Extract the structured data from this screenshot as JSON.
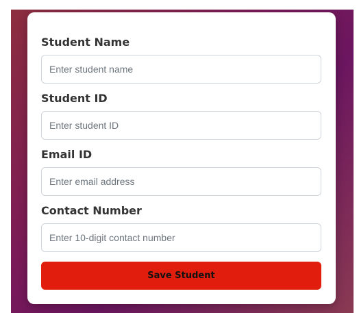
{
  "form": {
    "fields": [
      {
        "label": "Student Name",
        "placeholder": "Enter student name",
        "value": ""
      },
      {
        "label": "Student ID",
        "placeholder": "Enter student ID",
        "value": ""
      },
      {
        "label": "Email ID",
        "placeholder": "Enter email address",
        "value": ""
      },
      {
        "label": "Contact Number",
        "placeholder": "Enter 10-digit contact number",
        "value": ""
      }
    ],
    "submit_label": "Save Student"
  },
  "colors": {
    "submit_button": "#e11d0e",
    "background_gradient": [
      "#8d2e3f",
      "#6b1660",
      "#8a3a52"
    ],
    "card": "#ffffff"
  }
}
